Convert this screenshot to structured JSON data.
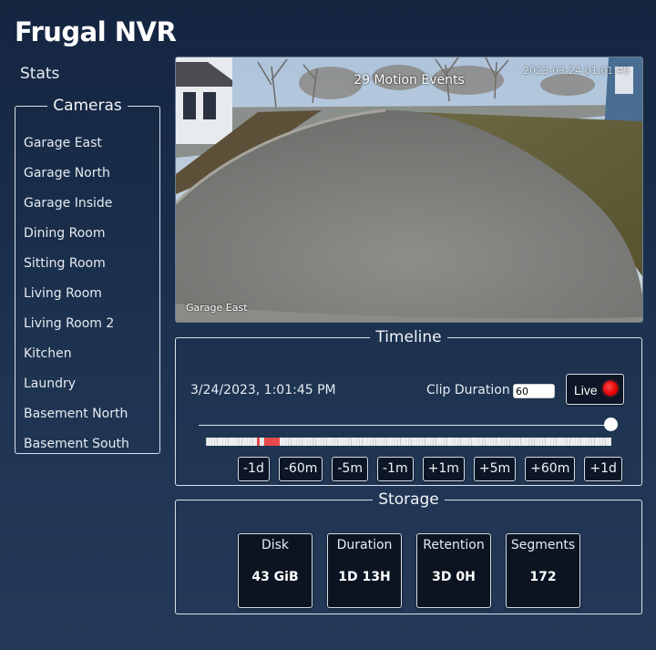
{
  "app": {
    "title": "Frugal NVR"
  },
  "nav": {
    "stats_label": "Stats"
  },
  "cameras": {
    "legend": "Cameras",
    "items": [
      "Garage East",
      "Garage North",
      "Garage Inside",
      "Dining Room",
      "Sitting Room",
      "Living Room",
      "Living Room 2",
      "Kitchen",
      "Laundry",
      "Basement North",
      "Basement South"
    ]
  },
  "video": {
    "motion_events": "29 Motion Events",
    "camera_caption": "Garage East",
    "osd_timestamp": "2023-03-24 01:01:45"
  },
  "timeline": {
    "legend": "Timeline",
    "datetime": "3/24/2023, 1:01:45 PM",
    "clip_duration_label": "Clip Duration",
    "clip_duration_value": "60",
    "live_label": "Live",
    "slider_value": 1.0,
    "buttons": [
      "-1d",
      "-60m",
      "-5m",
      "-1m",
      "+1m",
      "+5m",
      "+60m",
      "+1d"
    ],
    "motion_color": "#e64a4a"
  },
  "storage": {
    "legend": "Storage",
    "cards": [
      {
        "title": "Disk",
        "value": "43 GiB"
      },
      {
        "title": "Duration",
        "value": "1D 13H"
      },
      {
        "title": "Retention",
        "value": "3D 0H"
      },
      {
        "title": "Segments",
        "value": "172"
      }
    ]
  },
  "colors": {
    "live_indicator": "#e30000",
    "panel_border": "#dbe2ea"
  }
}
